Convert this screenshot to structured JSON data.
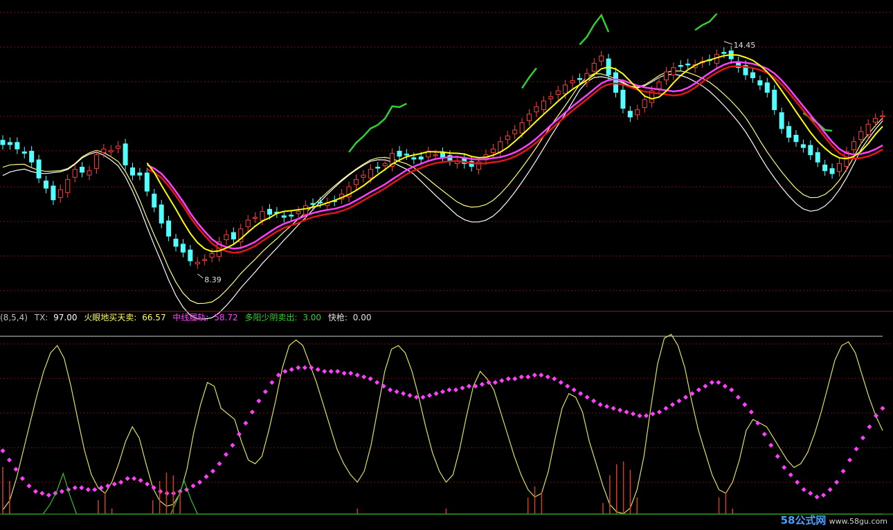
{
  "colors": {
    "background": "#000000",
    "grid": "#7a1010",
    "divider": "#a01818",
    "candle_up": "#ff4040",
    "candle_down": "#54ffff",
    "env_outer": "#ffffff",
    "env_inner": "#ffff80",
    "ma_red": "#e01818",
    "ma_magenta": "#ff40ff",
    "ma_yellow": "#ffff00",
    "signal_green": "#30d030",
    "osc_yellow": "#e0e060",
    "osc_white": "#ffffff",
    "osc_dots": "#ff40ff",
    "osc_green": "#30c030",
    "osc_bars": "#d04020"
  },
  "chart_data": [
    {
      "type": "candlestick",
      "panel": "price",
      "annotations": [
        {
          "text": "14.45",
          "kind": "high-marker"
        },
        {
          "text": "8.39",
          "kind": "low-marker"
        }
      ],
      "series_closes": [
        17.0,
        17.0,
        16.7,
        16.4,
        15.8,
        14.7,
        14.0,
        13.2,
        13.9,
        14.6,
        15.3,
        15.1,
        15.2,
        16.3,
        16.7,
        16.6,
        16.9,
        15.6,
        14.9,
        14.9,
        13.8,
        12.7,
        11.6,
        10.7,
        10.0,
        9.6,
        9.0,
        8.9,
        9.1,
        9.5,
        10.3,
        10.8,
        10.5,
        11.2,
        11.8,
        12.0,
        12.4,
        12.2,
        12.3,
        12.0,
        12.1,
        12.4,
        12.8,
        12.9,
        13.0,
        13.0,
        13.1,
        13.6,
        14.1,
        14.6,
        14.9,
        15.3,
        15.4,
        15.7,
        16.4,
        16.2,
        16.3,
        16.0,
        16.0,
        16.5,
        16.3,
        16.1,
        15.9,
        15.9,
        15.7,
        15.5,
        15.8,
        16.3,
        16.7,
        17.2,
        17.6,
        18.0,
        18.5,
        19.1,
        19.6,
        20.0,
        20.3,
        20.7,
        21.1,
        21.4,
        21.5,
        21.9,
        22.6,
        23.1,
        21.8,
        20.6,
        19.5,
        18.9,
        19.4,
        20.1,
        20.7,
        21.3,
        22.0,
        22.3,
        22.4,
        22.5,
        22.5,
        22.7,
        22.8,
        23.2,
        23.3,
        22.9,
        22.3,
        21.8,
        21.6,
        21.1,
        20.6,
        19.4,
        18.1,
        17.5,
        17.2,
        16.8,
        16.3,
        15.8,
        15.2,
        15.0,
        15.7,
        16.5,
        17.2,
        17.9,
        18.4,
        18.8,
        19.0
      ]
    },
    {
      "type": "line",
      "panel": "oscillator",
      "title": "(8,5,4)",
      "legend": [
        {
          "label": "TX:",
          "value": "97.00"
        },
        {
          "label": "火眼地买天卖:",
          "value": "66.57"
        },
        {
          "label": "中线履轨:",
          "value": "58.72"
        },
        {
          "label": "多阳少阴卖出:",
          "value": "3.00"
        },
        {
          "label": "快枪:",
          "value": "0.00"
        }
      ],
      "ylim": [
        0,
        100
      ],
      "reference_level": 97,
      "series": [
        {
          "name": "火眼地买天卖",
          "values": [
            3,
            8,
            20,
            35,
            50,
            65,
            78,
            88,
            92,
            85,
            70,
            52,
            35,
            22,
            15,
            12,
            18,
            28,
            40,
            48,
            42,
            28,
            15,
            8,
            5,
            6,
            12,
            25,
            45,
            60,
            72,
            70,
            58,
            55,
            52,
            40,
            30,
            28,
            32,
            46,
            62,
            80,
            92,
            95,
            92,
            82,
            72,
            60,
            48,
            36,
            28,
            22,
            18,
            24,
            38,
            58,
            78,
            90,
            92,
            88,
            78,
            64,
            48,
            34,
            24,
            18,
            22,
            36,
            54,
            70,
            78,
            74,
            68,
            56,
            44,
            32,
            22,
            14,
            10,
            12,
            24,
            42,
            58,
            66,
            64,
            56,
            40,
            28,
            16,
            6,
            2,
            1,
            4,
            14,
            32,
            58,
            82,
            96,
            98,
            92,
            80,
            62,
            46,
            34,
            22,
            14,
            12,
            18,
            30,
            46,
            52,
            50,
            48,
            42,
            36,
            30,
            26,
            28,
            34,
            44,
            56,
            70,
            84,
            92,
            94,
            88,
            76,
            64,
            54,
            46
          ]
        },
        {
          "name": "中线履轨",
          "values": [
            35,
            30,
            25,
            20,
            16,
            13,
            12,
            11,
            12,
            13,
            14,
            15,
            15,
            14,
            14,
            15,
            16,
            17,
            18,
            20,
            20,
            19,
            17,
            15,
            13,
            12,
            12,
            13,
            14,
            16,
            18,
            21,
            24,
            28,
            33,
            38,
            44,
            50,
            56,
            62,
            67,
            72,
            76,
            78,
            79,
            80,
            80,
            80,
            79,
            78,
            78,
            78,
            77,
            77,
            76,
            75,
            74,
            72,
            70,
            68,
            67,
            66,
            65,
            64,
            64,
            65,
            66,
            67,
            68,
            68,
            69,
            70,
            70,
            71,
            72,
            72,
            73,
            74,
            74,
            75,
            75,
            76,
            76,
            75,
            74,
            72,
            70,
            68,
            66,
            64,
            62,
            60,
            59,
            58,
            57,
            56,
            55,
            54,
            54,
            55,
            56,
            58,
            60,
            62,
            64,
            66,
            68,
            70,
            72,
            72,
            70,
            68,
            64,
            60,
            56,
            50,
            44,
            38,
            32,
            26,
            22,
            18,
            14,
            12,
            10,
            11,
            14,
            18,
            24,
            30,
            36,
            42,
            48,
            54,
            58
          ]
        },
        {
          "name": "多阳少阴卖出",
          "values": [
            0,
            0,
            0,
            0,
            0,
            0,
            0,
            5,
            12,
            22,
            10,
            0,
            0,
            0,
            0,
            0,
            0,
            0,
            0,
            0,
            0,
            0,
            0,
            0,
            0,
            0,
            8,
            18,
            8,
            0,
            0,
            0,
            0,
            0,
            0,
            0,
            0,
            0,
            0,
            0,
            0,
            0,
            0,
            0,
            0,
            0,
            0,
            0,
            0,
            0,
            0,
            0,
            0,
            0,
            0,
            0,
            0,
            0,
            0,
            0,
            0,
            0,
            0,
            0,
            0,
            0,
            0,
            0,
            0,
            0,
            0,
            0,
            0,
            0,
            0,
            0,
            0,
            0,
            0,
            0,
            0,
            0,
            0,
            0,
            0,
            0,
            0,
            0,
            0,
            0,
            0,
            0,
            0,
            0,
            0,
            0,
            0,
            0,
            0,
            0,
            0,
            0,
            0,
            0,
            0,
            0,
            0,
            0,
            0,
            0,
            0,
            0,
            0,
            0,
            0,
            0,
            0,
            0,
            0,
            0,
            0,
            0,
            0,
            0,
            0,
            0,
            0,
            0,
            0,
            0,
            0,
            0
          ]
        },
        {
          "name": "快枪",
          "values": [
            0,
            0,
            0,
            0,
            0,
            0,
            0,
            0,
            0,
            0,
            0,
            0,
            0,
            0,
            0,
            0,
            0,
            0,
            0,
            0,
            0,
            0,
            0,
            0,
            0,
            0,
            0,
            0,
            0,
            0,
            0,
            0,
            0,
            0,
            0,
            0,
            0,
            0,
            0,
            0,
            0,
            0,
            0,
            0,
            0,
            0,
            0,
            0,
            0,
            0,
            0,
            0,
            0,
            0,
            0,
            0,
            0,
            0,
            0,
            0,
            0,
            0,
            0,
            0,
            0,
            0,
            0,
            0,
            0,
            0,
            0,
            0,
            0,
            0,
            0,
            0,
            0,
            0,
            0,
            0,
            0,
            0,
            0,
            0,
            0,
            0,
            0,
            0,
            0,
            0,
            0,
            0,
            0,
            0,
            0,
            0,
            0,
            0,
            0,
            0,
            0,
            0,
            0,
            0,
            0,
            0,
            0,
            0,
            0,
            0,
            0,
            0,
            0,
            0,
            0,
            0,
            0,
            0,
            0,
            0,
            0,
            0,
            0,
            0,
            0,
            0,
            0,
            0,
            0,
            0,
            0,
            0,
            0,
            0,
            0
          ]
        }
      ]
    }
  ],
  "watermark": {
    "brand": "58公式网",
    "url": "www.58gu.com"
  }
}
